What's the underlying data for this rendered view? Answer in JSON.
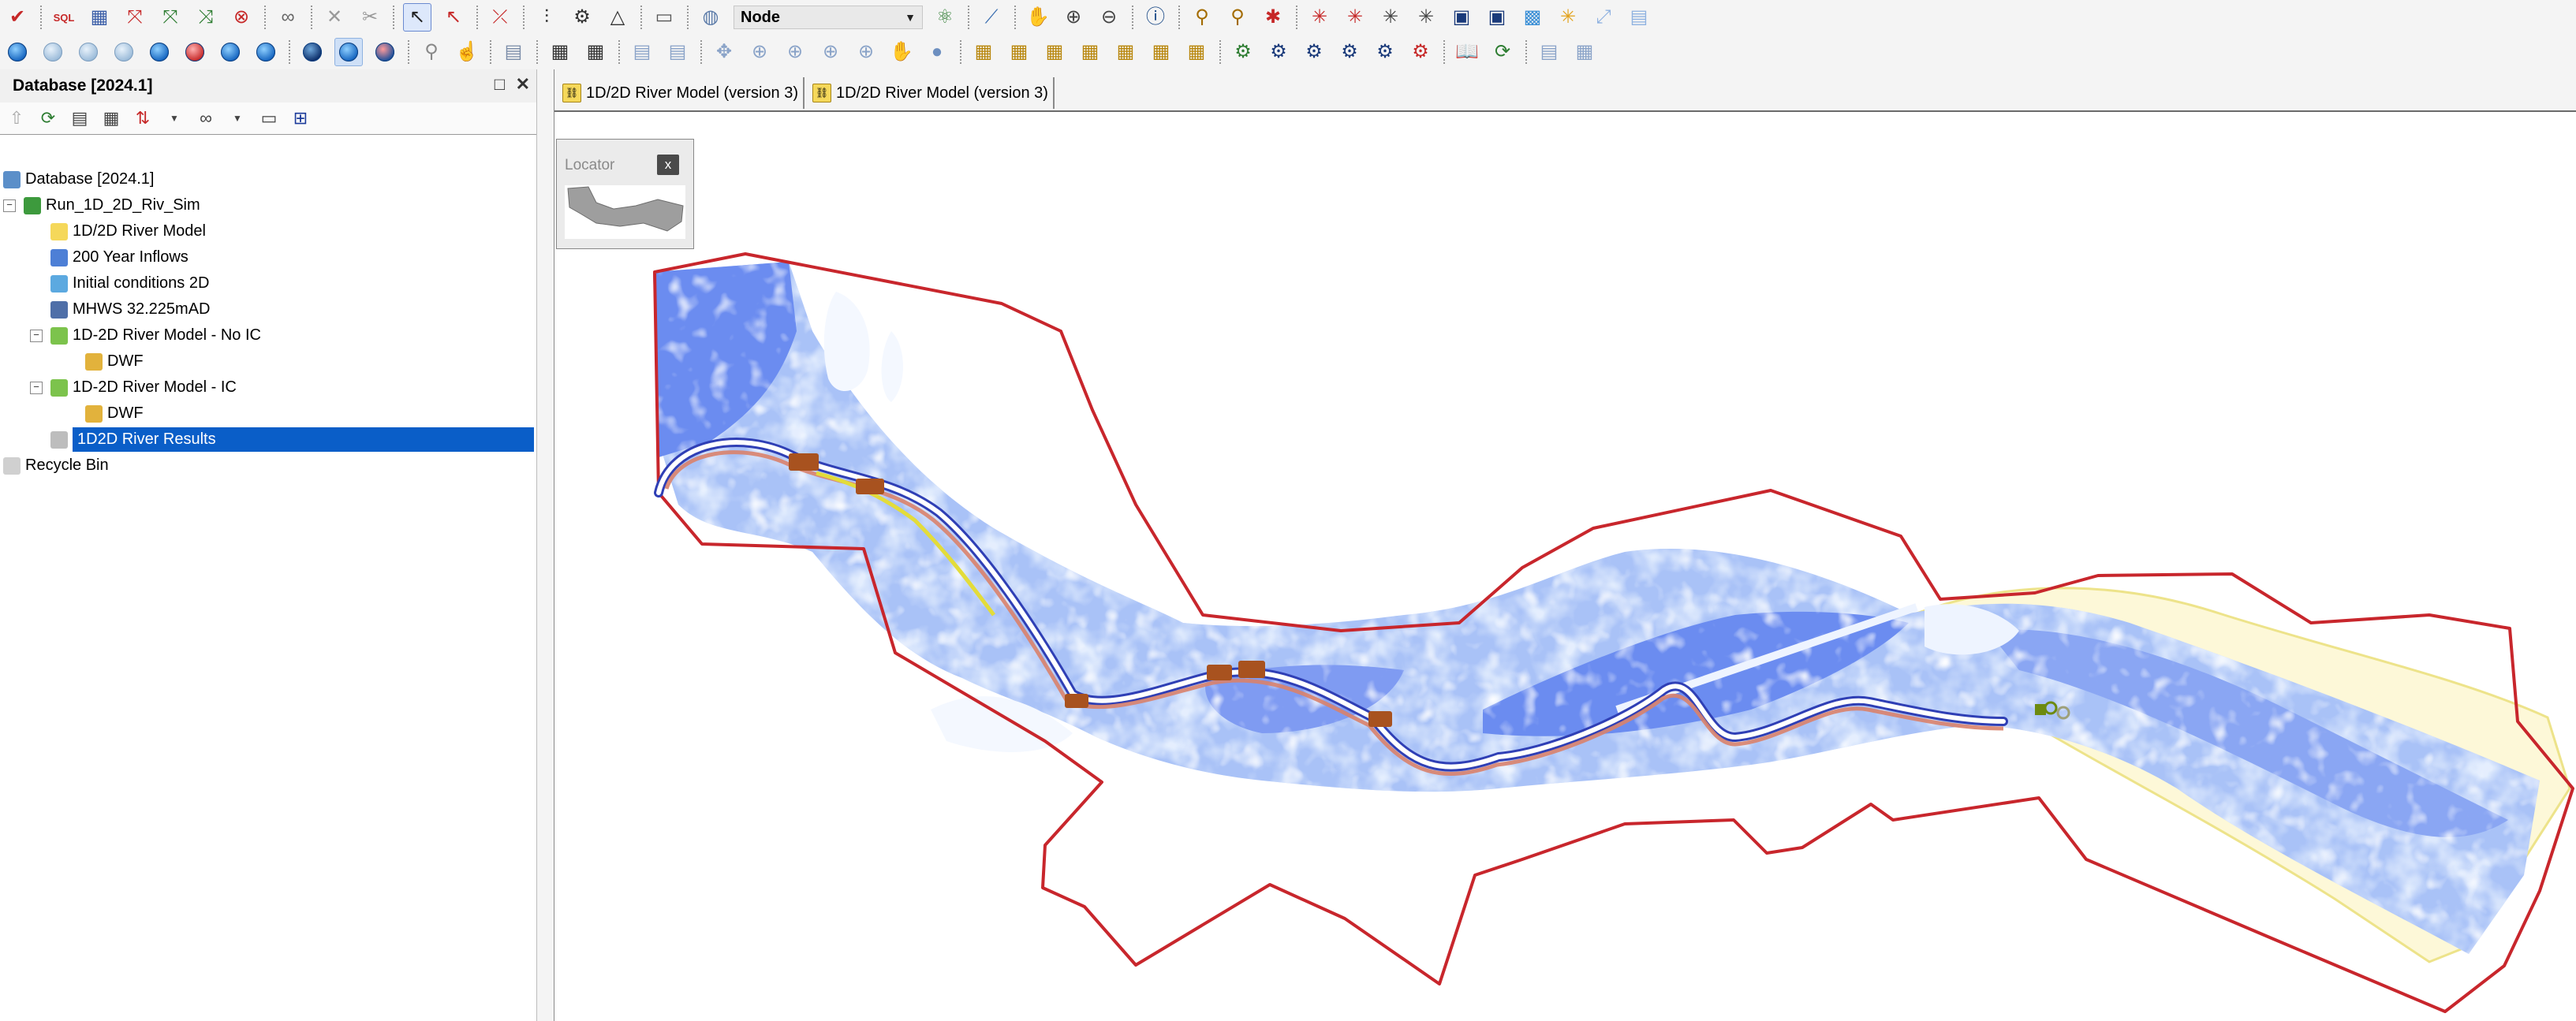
{
  "toolbar1": {
    "items": [
      "validate",
      "sql",
      "grid",
      "net-a",
      "net-b",
      "net-c",
      "net-d",
      "binoculars",
      "delete",
      "cut-link",
      "select",
      "select-red",
      "measure-a",
      "measure-b",
      "measure-c",
      "measure-d",
      "ruler",
      "globe"
    ],
    "combo_value": "Node",
    "items_after": [
      "flow-a",
      "pipe",
      "hand",
      "zoom-in",
      "zoom-out",
      "info",
      "find-a",
      "find-b",
      "tool-a",
      "tool-b",
      "tool-c",
      "tool-d",
      "image-a",
      "image-b",
      "image-c",
      "image-d",
      "tool-e",
      "tool-f"
    ]
  },
  "toolbar2": {
    "playback": [
      "rewind",
      "step-back",
      "pause-back",
      "step-fwd",
      "play",
      "record",
      "loop",
      "fast-fwd",
      "graph",
      "help",
      "stop"
    ],
    "tools": [
      "zoom-a",
      "hand-b",
      "grid-a",
      "grid-b",
      "grid-c",
      "pan",
      "zoom-c",
      "zoom-d",
      "zoom-e",
      "zoom-f",
      "hand-c",
      "circle",
      "grid-d",
      "grid-e",
      "grid-f",
      "grid-g",
      "grid-h",
      "grid-i",
      "grid-j",
      "net-e",
      "net-f",
      "net-g",
      "net-h",
      "net-i",
      "net-j",
      "book",
      "refresh",
      "grid-k",
      "grid-l"
    ]
  },
  "panel": {
    "title": "Database [2024.1]",
    "tree": [
      {
        "label": "Database [2024.1]",
        "level": 0,
        "icon": "database-icon",
        "color": "#5b8fc9",
        "expander": ""
      },
      {
        "label": "Run_1D_2D_Riv_Sim",
        "level": 0,
        "icon": "run-icon",
        "color": "#3d9a3d",
        "expander": "⊟"
      },
      {
        "label": "1D/2D River Model",
        "level": 1,
        "icon": "network-icon",
        "color": "#f5d85a",
        "expander": ""
      },
      {
        "label": "200 Year Inflows",
        "level": 1,
        "icon": "inflow-icon",
        "color": "#4d7fd6",
        "expander": ""
      },
      {
        "label": "Initial conditions 2D",
        "level": 1,
        "icon": "ic2d-icon",
        "color": "#5ca9e0",
        "expander": ""
      },
      {
        "label": "MHWS 32.225mAD",
        "level": 1,
        "icon": "level-icon",
        "color": "#4f6fa8",
        "expander": ""
      },
      {
        "label": "1D-2D River Model - No IC",
        "level": 1,
        "icon": "sim-icon",
        "color": "#7cc34c",
        "expander": "⊟"
      },
      {
        "label": "DWF",
        "level": 2,
        "icon": "dwf-icon",
        "color": "#e2b23c",
        "expander": ""
      },
      {
        "label": "1D-2D River Model - IC",
        "level": 1,
        "icon": "sim-icon",
        "color": "#7cc34c",
        "expander": "⊟"
      },
      {
        "label": "DWF",
        "level": 2,
        "icon": "dwf-icon",
        "color": "#e2b23c",
        "expander": ""
      },
      {
        "label": "1D2D River Results",
        "level": 1,
        "icon": "results-icon",
        "color": "#bdbdbd",
        "expander": "",
        "selected": true
      },
      {
        "label": "Recycle Bin",
        "level": 0,
        "icon": "recycle-bin-icon",
        "color": "#d0d0d0",
        "expander": ""
      }
    ]
  },
  "tabs": [
    "1D/2D River Model (version 3)",
    "1D/2D River Model (version 3)"
  ],
  "locator": {
    "title": "Locator",
    "close": "x"
  },
  "colors": {
    "selection": "#0a5ec8",
    "boundary": "#c8262c",
    "river": "#2f3fb5",
    "flood_deep": "#6f8ff0",
    "flood_light": "#c9dcfb",
    "zone": "#fdf8d8"
  }
}
